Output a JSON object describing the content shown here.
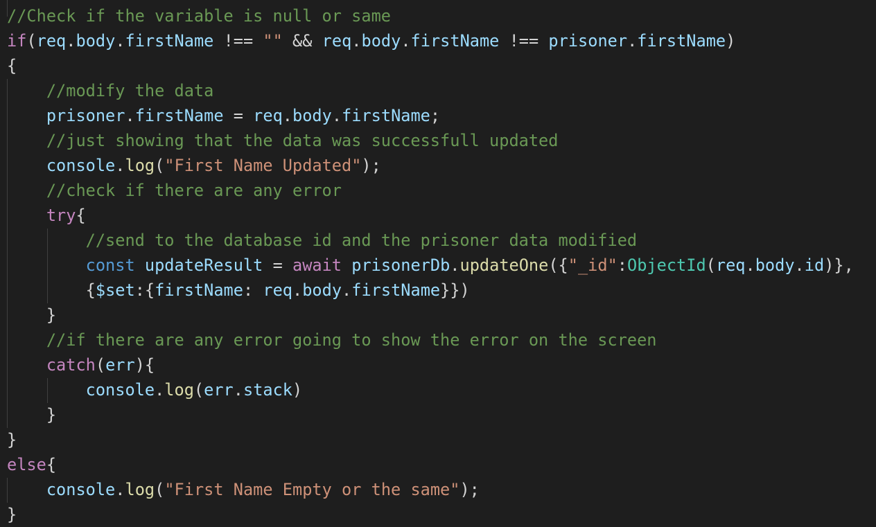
{
  "theme": {
    "background": "#1e1e1e",
    "default_text": "#d4d4d4",
    "comment": "#6a9955",
    "keyword": "#c586c0",
    "storage": "#569cd6",
    "variable": "#9cdcfe",
    "function": "#dcdcaa",
    "string": "#ce9178",
    "class": "#4ec9b0",
    "indent_guide": "#404040"
  },
  "code": {
    "lines": [
      [
        [
          "comment",
          "//Check if the variable is null or same"
        ]
      ],
      [
        [
          "keyword",
          "if"
        ],
        [
          "punct",
          "("
        ],
        [
          "variable",
          "req"
        ],
        [
          "punct",
          "."
        ],
        [
          "variable",
          "body"
        ],
        [
          "punct",
          "."
        ],
        [
          "variable",
          "firstName"
        ],
        [
          "punct",
          " !== "
        ],
        [
          "string",
          "\"\""
        ],
        [
          "punct",
          " && "
        ],
        [
          "variable",
          "req"
        ],
        [
          "punct",
          "."
        ],
        [
          "variable",
          "body"
        ],
        [
          "punct",
          "."
        ],
        [
          "variable",
          "firstName"
        ],
        [
          "punct",
          " !== "
        ],
        [
          "variable",
          "prisoner"
        ],
        [
          "punct",
          "."
        ],
        [
          "variable",
          "firstName"
        ],
        [
          "punct",
          ")"
        ]
      ],
      [
        [
          "punct",
          "{"
        ]
      ],
      [
        [
          "punct",
          "    "
        ],
        [
          "comment",
          "//modify the data"
        ]
      ],
      [
        [
          "punct",
          "    "
        ],
        [
          "variable",
          "prisoner"
        ],
        [
          "punct",
          "."
        ],
        [
          "variable",
          "firstName"
        ],
        [
          "punct",
          " = "
        ],
        [
          "variable",
          "req"
        ],
        [
          "punct",
          "."
        ],
        [
          "variable",
          "body"
        ],
        [
          "punct",
          "."
        ],
        [
          "variable",
          "firstName"
        ],
        [
          "punct",
          ";"
        ]
      ],
      [
        [
          "punct",
          "    "
        ],
        [
          "comment",
          "//just showing that the data was successfull updated"
        ]
      ],
      [
        [
          "punct",
          "    "
        ],
        [
          "variable",
          "console"
        ],
        [
          "punct",
          "."
        ],
        [
          "function",
          "log"
        ],
        [
          "punct",
          "("
        ],
        [
          "string",
          "\"First Name Updated\""
        ],
        [
          "punct",
          ");"
        ]
      ],
      [
        [
          "punct",
          "    "
        ],
        [
          "comment",
          "//check if there are any error"
        ]
      ],
      [
        [
          "punct",
          "    "
        ],
        [
          "keyword",
          "try"
        ],
        [
          "punct",
          "{"
        ]
      ],
      [
        [
          "punct",
          "        "
        ],
        [
          "comment",
          "//send to the database id and the prisoner data modified"
        ]
      ],
      [
        [
          "punct",
          "        "
        ],
        [
          "storage",
          "const"
        ],
        [
          "punct",
          " "
        ],
        [
          "variable",
          "updateResult"
        ],
        [
          "punct",
          " = "
        ],
        [
          "keyword",
          "await"
        ],
        [
          "punct",
          " "
        ],
        [
          "variable",
          "prisonerDb"
        ],
        [
          "punct",
          "."
        ],
        [
          "function",
          "updateOne"
        ],
        [
          "punct",
          "({"
        ],
        [
          "string",
          "\"_id\""
        ],
        [
          "punct",
          ":"
        ],
        [
          "class",
          "ObjectId"
        ],
        [
          "punct",
          "("
        ],
        [
          "variable",
          "req"
        ],
        [
          "punct",
          "."
        ],
        [
          "variable",
          "body"
        ],
        [
          "punct",
          "."
        ],
        [
          "variable",
          "id"
        ],
        [
          "punct",
          ")},"
        ]
      ],
      [
        [
          "punct",
          "        "
        ],
        [
          "punct",
          "{"
        ],
        [
          "variable",
          "$set"
        ],
        [
          "punct",
          ":{"
        ],
        [
          "variable",
          "firstName"
        ],
        [
          "punct",
          ": "
        ],
        [
          "variable",
          "req"
        ],
        [
          "punct",
          "."
        ],
        [
          "variable",
          "body"
        ],
        [
          "punct",
          "."
        ],
        [
          "variable",
          "firstName"
        ],
        [
          "punct",
          "}})"
        ]
      ],
      [
        [
          "punct",
          "    "
        ],
        [
          "punct",
          "}"
        ]
      ],
      [
        [
          "punct",
          "    "
        ],
        [
          "comment",
          "//if there are any error going to show the error on the screen"
        ]
      ],
      [
        [
          "punct",
          "    "
        ],
        [
          "keyword",
          "catch"
        ],
        [
          "punct",
          "("
        ],
        [
          "variable",
          "err"
        ],
        [
          "punct",
          "){"
        ]
      ],
      [
        [
          "punct",
          "        "
        ],
        [
          "variable",
          "console"
        ],
        [
          "punct",
          "."
        ],
        [
          "function",
          "log"
        ],
        [
          "punct",
          "("
        ],
        [
          "variable",
          "err"
        ],
        [
          "punct",
          "."
        ],
        [
          "variable",
          "stack"
        ],
        [
          "punct",
          ")"
        ]
      ],
      [
        [
          "punct",
          "    "
        ],
        [
          "punct",
          "}"
        ]
      ],
      [
        [
          "punct",
          "}"
        ]
      ],
      [
        [
          "keyword",
          "else"
        ],
        [
          "punct",
          "{"
        ]
      ],
      [
        [
          "punct",
          "    "
        ],
        [
          "variable",
          "console"
        ],
        [
          "punct",
          "."
        ],
        [
          "function",
          "log"
        ],
        [
          "punct",
          "("
        ],
        [
          "string",
          "\"First Name Empty or the same\""
        ],
        [
          "punct",
          ");"
        ]
      ],
      [
        [
          "punct",
          "}"
        ]
      ]
    ]
  }
}
